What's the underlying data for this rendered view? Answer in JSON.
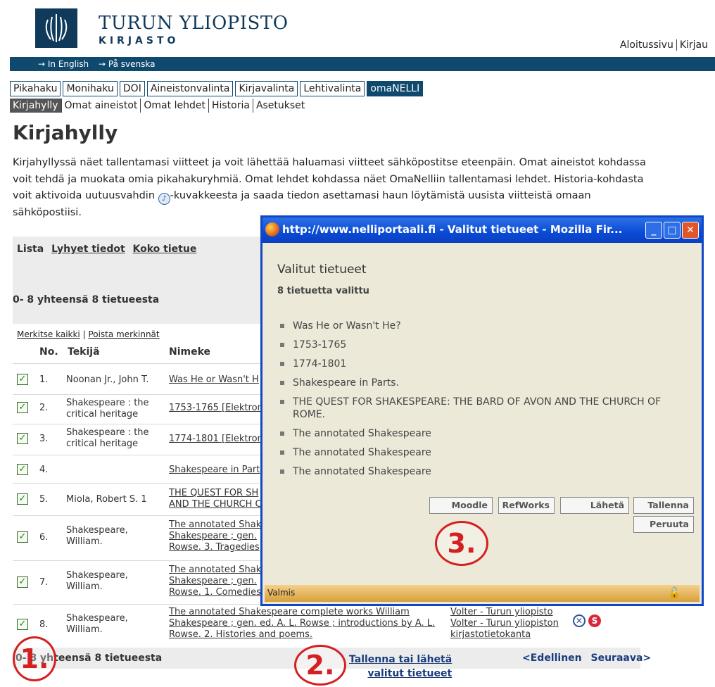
{
  "header": {
    "university": "TURUN YLIOPISTO",
    "library": "KIRJASTO",
    "top_links": [
      "Aloitussivu",
      "Kirjau"
    ],
    "lang_links": [
      "→ In English",
      "→ På svenska"
    ]
  },
  "tabs": [
    "Pikahaku",
    "Monihaku",
    "DOI",
    "Aineistonvalinta",
    "Kirjavalinta",
    "Lehtivalinta",
    "omaNELLI"
  ],
  "subtabs": [
    "Kirjahylly",
    "Omat aineistot",
    "Omat lehdet",
    "Historia",
    "Asetukset"
  ],
  "page_title": "Kirjahylly",
  "intro_before_icon": "Kirjahyllyssä näet tallentamasi viitteet ja voit lähettää haluamasi viitteet sähköpostitse eteenpäin. Omat aineistot kohdassa voit tehdä ja muokata omia pikahakuryhmiä. Omat lehdet kohdassa näet OmaNelliin tallentamasi lehdet. Historia-kohdasta voit aktivoida uutuusvahdin",
  "intro_after_icon": "-kuvakkeesta ja saada tiedon asettamasi haun löytämistä uusista viitteistä omaan sähköpostiisi.",
  "list": {
    "view_lista": "Lista",
    "view_short": "Lyhyet tiedot",
    "view_full": "Koko tietue",
    "count_top": "0- 8 yhteensä 8 tietueesta",
    "mark_all": "Merkitse kaikki",
    "unmark": "Poista merkinnät",
    "col_no": "No.",
    "col_author": "Tekijä",
    "col_title": "Nimeke",
    "rows": [
      {
        "no": "1.",
        "author": "Noonan Jr., John T.",
        "title": "Was He or Wasn't H",
        "links": []
      },
      {
        "no": "2.",
        "author": "Shakespeare : the critical heritage",
        "title": "1753-1765 [Elektroni",
        "links": []
      },
      {
        "no": "3.",
        "author": "Shakespeare : the critical heritage",
        "title": "1774-1801 [Elektroni",
        "links": []
      },
      {
        "no": "4.",
        "author": "",
        "title": "Shakespeare in Part",
        "links": []
      },
      {
        "no": "5.",
        "author": "Miola, Robert S. 1",
        "title": "THE QUEST FOR SH AND THE CHURCH C",
        "links": []
      },
      {
        "no": "6.",
        "author": "Shakespeare, William.",
        "title": "The annotated Shake Shakespeare ; gen. Rowse. 3. Tragedies",
        "links": []
      },
      {
        "no": "7.",
        "author": "Shakespeare, William.",
        "title": "The annotated Shake Shakespeare ; gen. Rowse. 1. Comedies",
        "links": []
      },
      {
        "no": "8.",
        "author": "Shakespeare, William.",
        "title": "The annotated Shakespeare complete works William Shakespeare ; gen. ed. A. L. Rowse ; introductions by A. L. Rowse. 2. Histories and poems.",
        "links": [
          "Volter - Turun yliopisto",
          "Volter - Turun yliopiston kirjastotietokanta"
        ]
      }
    ],
    "count_bottom": "0- 8 yhteensä 8 tietueesta",
    "save_send_1": "Tallenna tai lähetä",
    "save_send_2": "valitut tietueet",
    "prev": "<Edellinen",
    "next": "Seuraava>"
  },
  "popup": {
    "window_title": "http://www.nelliportaali.fi - Valitut tietueet - Mozilla Fir...",
    "title": "Valitut tietueet",
    "subtitle": "8 tietuetta valittu",
    "items": [
      "Was He or Wasn't He?",
      "1753-1765",
      "1774-1801",
      "Shakespeare in Parts.",
      "THE QUEST FOR SHAKESPEARE: THE BARD OF AVON AND THE CHURCH OF ROME.",
      "The annotated Shakespeare",
      "The annotated Shakespeare",
      "The annotated Shakespeare"
    ],
    "btn_moodle": "Moodle",
    "btn_refworks": "RefWorks",
    "btn_send": "Lähetä",
    "btn_save": "Tallenna",
    "btn_cancel": "Peruuta",
    "status": "Valmis"
  },
  "annotations": [
    "1.",
    "2.",
    "3."
  ]
}
